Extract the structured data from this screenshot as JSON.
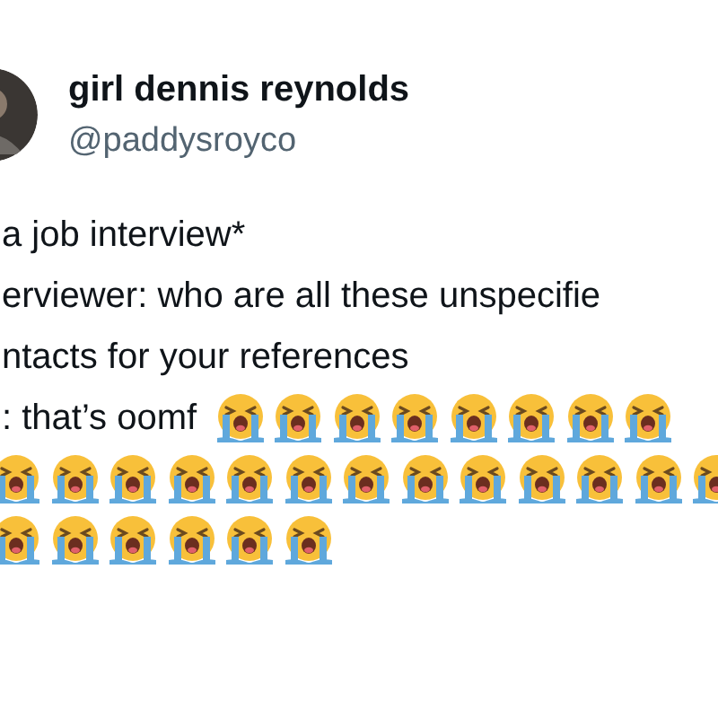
{
  "author": {
    "name": "girl dennis reynolds",
    "handle": "@paddysroyco"
  },
  "lines": [
    {
      "text": "a job interview*"
    },
    {
      "text": "erviewer: who are all these unspecifie"
    },
    {
      "text": "ntacts for your references"
    },
    {
      "text": ": that’s oomf",
      "emoji": [
        {
          "kind": "loudly_crying"
        },
        {
          "kind": "loudly_crying"
        },
        {
          "kind": "loudly_crying"
        },
        {
          "kind": "loudly_crying"
        },
        {
          "kind": "loudly_crying"
        },
        {
          "kind": "loudly_crying"
        },
        {
          "kind": "loudly_crying"
        },
        {
          "kind": "loudly_crying"
        }
      ]
    },
    {
      "emoji": [
        {
          "kind": "loudly_crying"
        },
        {
          "kind": "loudly_crying"
        },
        {
          "kind": "loudly_crying"
        },
        {
          "kind": "loudly_crying"
        },
        {
          "kind": "loudly_crying"
        },
        {
          "kind": "loudly_crying"
        },
        {
          "kind": "loudly_crying"
        },
        {
          "kind": "loudly_crying"
        },
        {
          "kind": "loudly_crying"
        },
        {
          "kind": "loudly_crying"
        },
        {
          "kind": "loudly_crying"
        },
        {
          "kind": "loudly_crying"
        },
        {
          "kind": "loudly_crying"
        }
      ]
    },
    {
      "emoji": [
        {
          "kind": "loudly_crying"
        },
        {
          "kind": "loudly_crying"
        },
        {
          "kind": "loudly_crying"
        },
        {
          "kind": "loudly_crying"
        },
        {
          "kind": "loudly_crying"
        },
        {
          "kind": "loudly_crying"
        }
      ]
    }
  ]
}
